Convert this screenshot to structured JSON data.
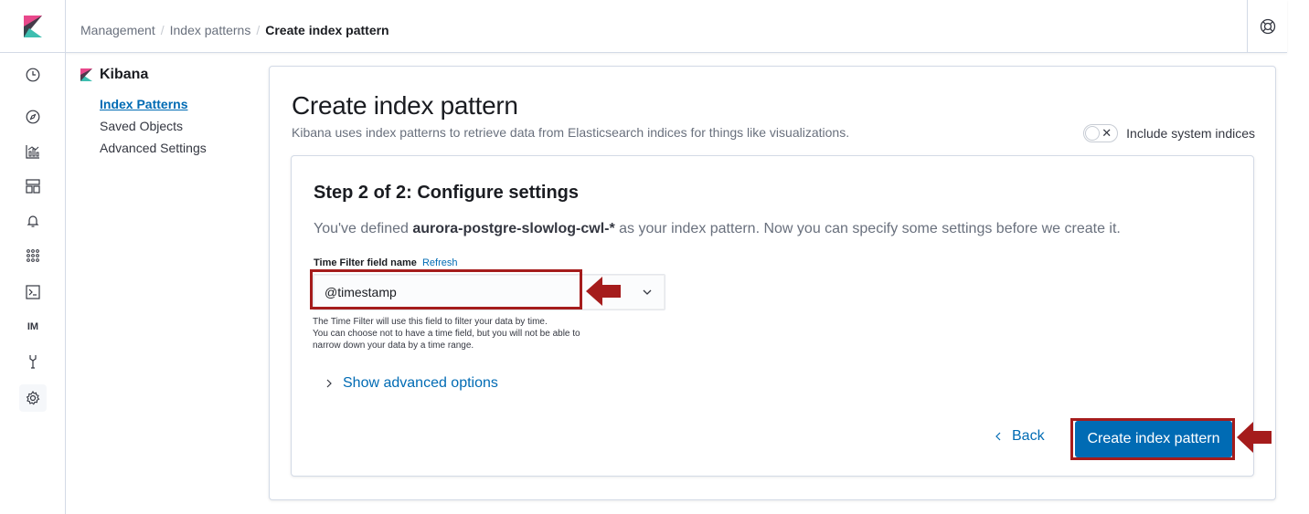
{
  "header": {
    "breadcrumbs": [
      "Management",
      "Index patterns",
      "Create index pattern"
    ],
    "separator": "/"
  },
  "sidenav": {
    "items": [
      "clock-icon",
      "compass-icon",
      "visualize-icon",
      "dashboard-icon",
      "alert-icon",
      "apps-icon",
      "console-icon",
      "IM",
      "wrench-icon",
      "gear-icon"
    ]
  },
  "leftmenu": {
    "title": "Kibana",
    "items": [
      {
        "label": "Index Patterns",
        "active": true
      },
      {
        "label": "Saved Objects",
        "active": false
      },
      {
        "label": "Advanced Settings",
        "active": false
      }
    ]
  },
  "page": {
    "title": "Create index pattern",
    "subtitle": "Kibana uses index patterns to retrieve data from Elasticsearch indices for things like visualizations.",
    "include_system_label": "Include system indices",
    "include_system_on": false
  },
  "step": {
    "title": "Step 2 of 2: Configure settings",
    "desc_prefix": "You've defined ",
    "pattern": "aurora-postgre-slowlog-cwl-*",
    "desc_suffix": " as your index pattern. Now you can specify some settings before we create it.",
    "field_label": "Time Filter field name",
    "refresh_label": "Refresh",
    "field_value": "@timestamp",
    "help_lines": [
      "The Time Filter will use this field to filter your data by time.",
      "You can choose not to have a time field, but you will not be able to",
      "narrow down your data by a time range."
    ],
    "advanced_label": "Show advanced options",
    "back_label": "Back",
    "create_label": "Create index pattern"
  },
  "colors": {
    "accent": "#006bb4",
    "highlight": "#a51c1c"
  }
}
